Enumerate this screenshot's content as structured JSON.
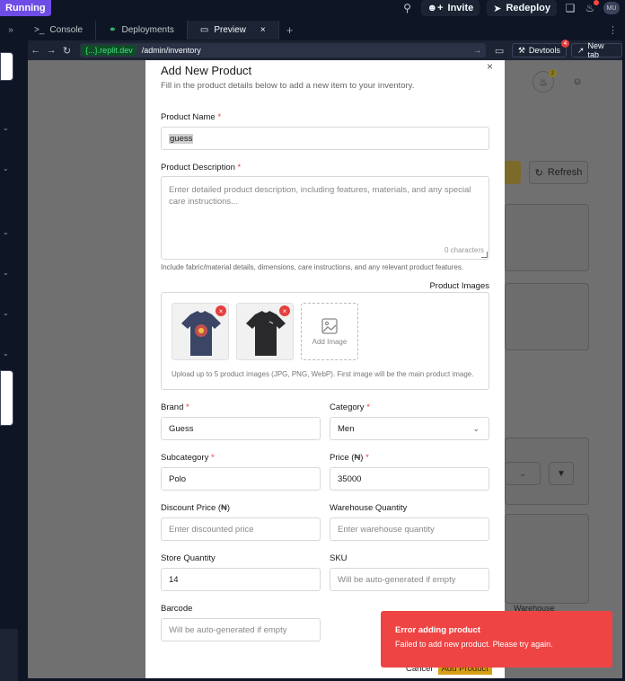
{
  "topbar": {
    "status": "Running",
    "invite_label": "Invite",
    "redeploy_label": "Redeploy",
    "avatar_initials": "MU"
  },
  "tabs": [
    {
      "label": "Console"
    },
    {
      "label": "Deployments"
    },
    {
      "label": "Preview"
    }
  ],
  "urlbar": {
    "host": "{...}.replit.dev",
    "path": "/admin/inventory",
    "devtools_label": "Devtools",
    "devtools_badge": "4",
    "newtab_label": "New tab"
  },
  "background": {
    "refresh_label": "Refresh",
    "bell_badge": "2",
    "warehouse_text": "Warehouse"
  },
  "modal": {
    "close": "×",
    "title": "Add New Product",
    "subtitle": "Fill in the product details below to add a new item to your inventory.",
    "product_name": {
      "label": "Product Name",
      "value": "guess"
    },
    "description": {
      "label": "Product Description",
      "placeholder": "Enter detailed product description, including features, materials, and any special care instructions...",
      "char_count": "0 characters",
      "hint": "Include fabric/material details, dimensions, care instructions, and any relevant product features."
    },
    "images": {
      "label": "Product Images",
      "add_label": "Add Image",
      "hint": "Upload up to 5 product images (JPG, PNG, WebP). First image will be the main product image."
    },
    "brand": {
      "label": "Brand",
      "value": "Guess"
    },
    "category": {
      "label": "Category",
      "value": "Men"
    },
    "subcategory": {
      "label": "Subcategory",
      "value": "Polo"
    },
    "price": {
      "label": "Price (₦)",
      "value": "35000"
    },
    "discount": {
      "label": "Discount Price (₦)",
      "placeholder": "Enter discounted price"
    },
    "warehouse_qty": {
      "label": "Warehouse Quantity",
      "placeholder": "Enter warehouse quantity"
    },
    "store_qty": {
      "label": "Store Quantity",
      "value": "14"
    },
    "sku": {
      "label": "SKU",
      "placeholder": "Will be auto-generated if empty"
    },
    "barcode": {
      "label": "Barcode",
      "placeholder": "Will be auto-generated if empty"
    },
    "cancel_label": "Cancel",
    "add_label": "Add Product"
  },
  "toast": {
    "title": "Error adding product",
    "message": "Failed to add new product. Please try again."
  },
  "colors": {
    "accent_purple": "#6d4de6",
    "error_red": "#ef4444",
    "primary_yellow": "#d4a017"
  }
}
